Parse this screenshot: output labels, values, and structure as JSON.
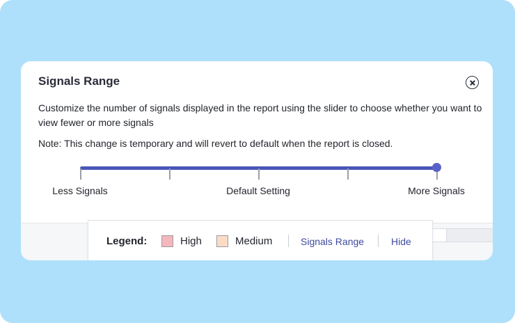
{
  "dialog": {
    "title": "Signals Range",
    "description": "Customize the number of signals displayed in the report using the slider to choose whether you want to view fewer or more signals",
    "note": "Note: This change is temporary and will revert to default when the report is closed.",
    "close_icon": "close-circle-icon"
  },
  "slider": {
    "labels": {
      "min": "Less Signals",
      "mid": "Default Setting",
      "max": "More Signals"
    },
    "value_fraction": 1.0,
    "tick_count": 5,
    "track_color": "#4a56b8",
    "thumb_color": "#5961c7"
  },
  "legend": {
    "label": "Legend:",
    "items": [
      {
        "label": "High",
        "color": "#f4b7bd"
      },
      {
        "label": "Medium",
        "color": "#fadcc6"
      }
    ],
    "signals_range_link": "Signals Range",
    "hide_link": "Hide",
    "link_color": "#3f4a9f"
  },
  "colors": {
    "background": "#aee0fb",
    "card": "#ffffff"
  }
}
